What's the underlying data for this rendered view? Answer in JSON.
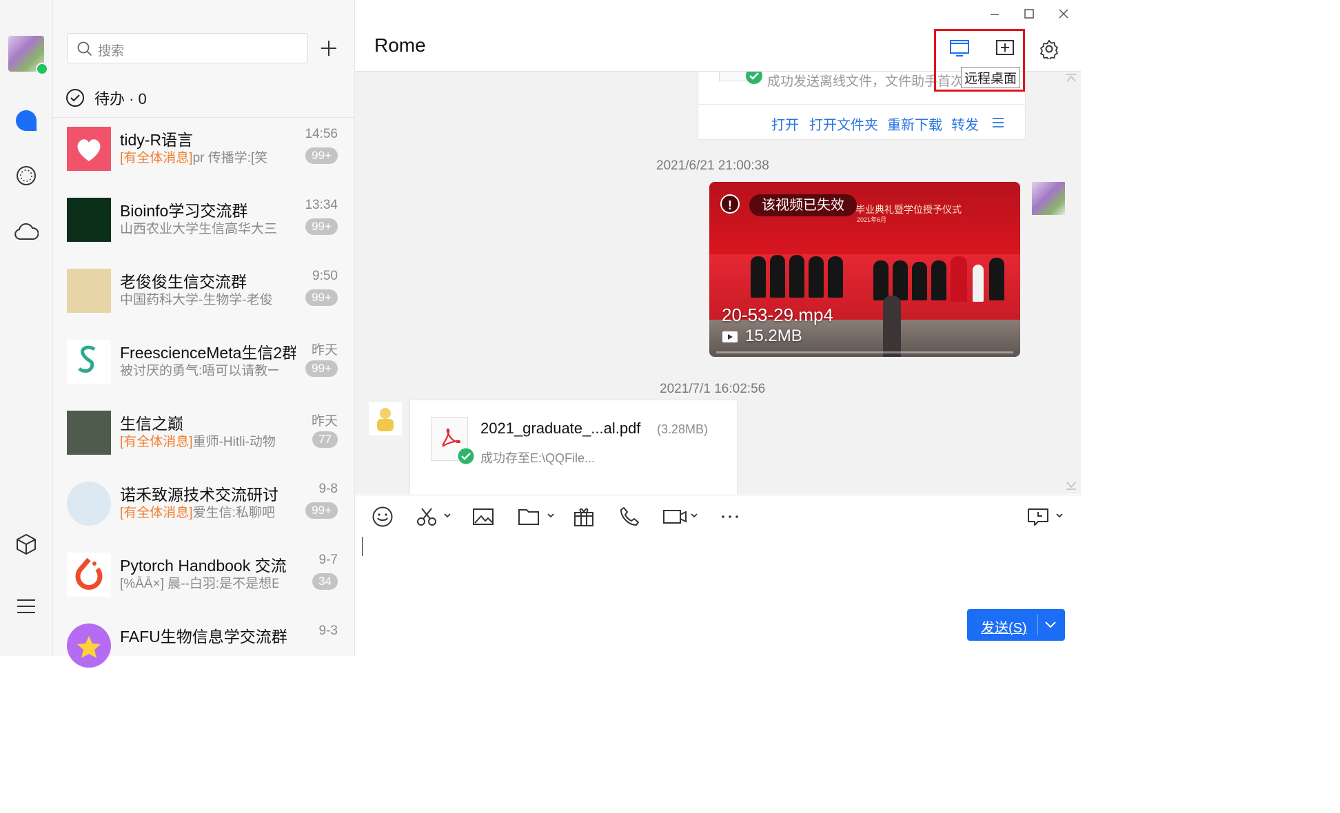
{
  "rail": {
    "items": [
      {
        "icon": "chat-bubble-icon"
      },
      {
        "icon": "clock-icon"
      },
      {
        "icon": "cloud-icon"
      },
      {
        "icon": "cube-icon"
      },
      {
        "icon": "menu-icon"
      }
    ]
  },
  "search": {
    "placeholder": "搜索"
  },
  "todo": {
    "label": "待办 · 0"
  },
  "contacts": [
    {
      "name": "tidy-R语言",
      "tag": "[有全体消息]",
      "preview": "pr 传播学:[笑",
      "time": "14:56",
      "badge": "99+",
      "avatar_color": "#f0536a"
    },
    {
      "name": "Bioinfo学习交流群",
      "tag": "",
      "preview": "山西农业大学生信高华大三",
      "time": "13:34",
      "badge": "99+",
      "avatar_color": "#0c2f1a"
    },
    {
      "name": "老俊俊生信交流群",
      "tag": "",
      "preview": "中国药科大学-生物学-老俊",
      "time": "9:50",
      "badge": "99+",
      "avatar_color": "#e7d4a7"
    },
    {
      "name": "FreescienceMeta生信2群",
      "tag": "",
      "preview": "被讨厌的勇气:唔可以请教一",
      "time": "昨天",
      "badge": "99+",
      "avatar_color": "#ffffff"
    },
    {
      "name": "生信之巅",
      "tag": "[有全体消息]",
      "preview": "重师-Hitli-动物",
      "time": "昨天",
      "badge": "77",
      "avatar_color": "#4f5b4c"
    },
    {
      "name": "诺禾致源技术交流研讨",
      "tag": "[有全体消息]",
      "preview": "爱生信:私聊吧",
      "time": "9-8",
      "badge": "99+",
      "avatar_color": "#dce9f2"
    },
    {
      "name": "Pytorch Handbook 交流",
      "tag": "",
      "preview": "[%ĀĀ×] 晨--白羽:是不是想E",
      "time": "9-7",
      "badge": "34",
      "avatar_color": "#ffffff"
    },
    {
      "name": "FAFU生物信息学交流群",
      "tag": "",
      "preview": "",
      "time": "9-3",
      "badge": "",
      "avatar_color": "#b56cf2"
    }
  ],
  "chat": {
    "title": "Rome",
    "tooltip": "远程桌面",
    "top_file": {
      "status": "成功发送离线文件，文件助手首次",
      "actions": [
        "打开",
        "打开文件夹",
        "重新下载",
        "转发"
      ]
    },
    "time1": "2021/6/21 21:00:38",
    "video": {
      "expired": "该视频已失效",
      "filename": "20-53-29.mp4",
      "size": "15.2MB",
      "banner": "毕业典礼暨学位授予仪式",
      "banner_date": "2021年6月"
    },
    "time2": "2021/7/1 16:02:56",
    "pdf": {
      "name": "2021_graduate_...al.pdf",
      "size": "(3.28MB)",
      "status": "成功存至E:\\QQFile..."
    },
    "send_label": "发送(S)"
  },
  "window": {
    "controls": [
      "minimize-icon",
      "maximize-icon",
      "close-icon"
    ]
  },
  "colors": {
    "accent": "#1b6ef5",
    "orange_tag": "#f07e2e",
    "highlight_box": "#e0141e",
    "online": "#1fc65b"
  }
}
